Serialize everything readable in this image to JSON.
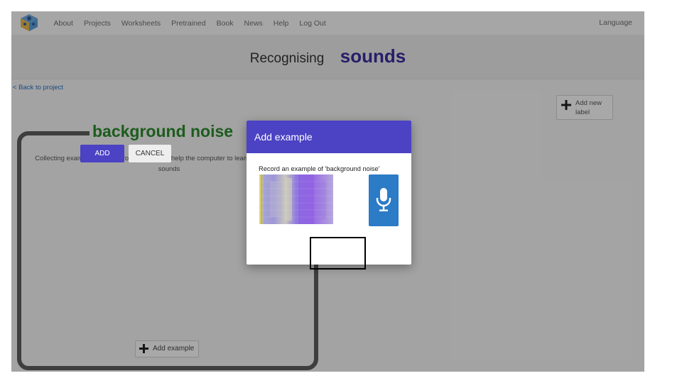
{
  "nav": {
    "links": [
      "About",
      "Projects",
      "Worksheets",
      "Pretrained",
      "Book",
      "News",
      "Help",
      "Log Out"
    ],
    "language": "Language"
  },
  "header": {
    "prefix": "Recognising",
    "title": "sounds"
  },
  "back_link": "< Back to project",
  "add_label_button": "Add new label",
  "label": {
    "name": "background noise",
    "description": "Collecting examples of background noise will help the computer to learn to recognise your sounds",
    "add_example_button": "Add example"
  },
  "dialog": {
    "title": "Add example",
    "prompt": "Record an example of 'background noise'",
    "add_button": "ADD",
    "cancel_button": "CANCEL"
  },
  "colors": {
    "accent": "#4b42c4",
    "mic_button": "#2c7bc6",
    "label_title": "#2b8a2b",
    "header_title": "#3a2e9e"
  },
  "icons": [
    "logo-icon",
    "plus-icon",
    "microphone-icon"
  ]
}
